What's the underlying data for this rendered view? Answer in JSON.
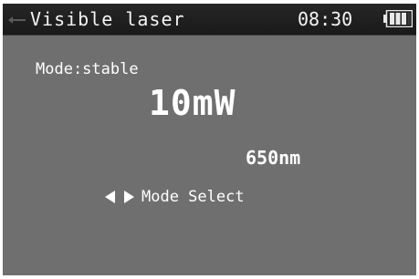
{
  "header": {
    "title": "Visible laser",
    "time": "08:30",
    "back_icon": "back-arrow-icon",
    "battery_icon": "battery-icon",
    "battery_level": 0.75
  },
  "main": {
    "mode_label": "Mode:stable",
    "power": "10mW",
    "wavelength": "650nm",
    "mode_select_icon": "left-right-arrows-icon",
    "mode_select_label": "Mode Select"
  },
  "colors": {
    "screen_background": "#6f6f6f",
    "titlebar_background": "#1e1e1e",
    "text": "#ffffff"
  }
}
